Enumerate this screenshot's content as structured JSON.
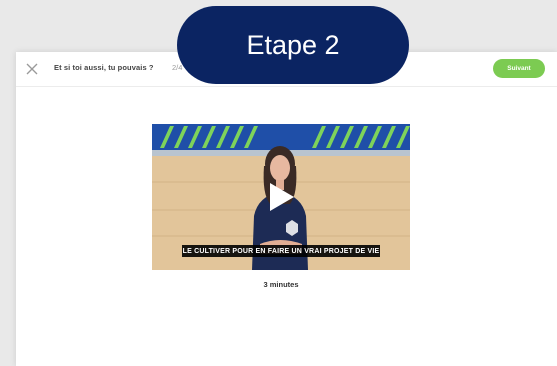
{
  "header": {
    "title": "Et si toi aussi, tu pouvais ?",
    "step_counter": "2/4",
    "next_label": "Suivant"
  },
  "badge": {
    "label": "Etape 2"
  },
  "video": {
    "caption": "LE CULTIVER POUR EN FAIRE UN VRAI PROJET DE VIE",
    "duration": "3 minutes"
  },
  "colors": {
    "accent_green": "#7ccb52",
    "badge_navy": "#0b2462",
    "stripe_blue": "#1f4fa8",
    "stripe_green": "#7ed35a"
  },
  "icons": {
    "close": "close-icon",
    "play": "play-icon"
  }
}
